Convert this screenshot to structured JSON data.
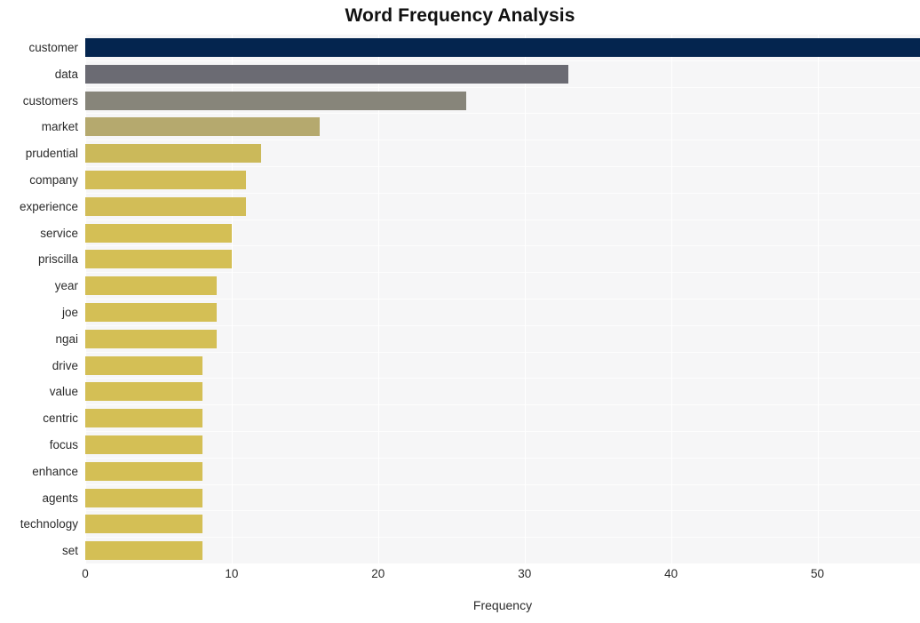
{
  "chart_data": {
    "type": "bar",
    "orientation": "horizontal",
    "title": "Word Frequency Analysis",
    "xlabel": "Frequency",
    "ylabel": "",
    "xlim": [
      0,
      57
    ],
    "ylim": null,
    "grid": true,
    "legend": null,
    "xticks": [
      0,
      10,
      20,
      30,
      40,
      50
    ],
    "xtick_labels": [
      "0",
      "10",
      "20",
      "30",
      "40",
      "50"
    ],
    "categories": [
      "customer",
      "data",
      "customers",
      "market",
      "prudential",
      "company",
      "experience",
      "service",
      "priscilla",
      "year",
      "joe",
      "ngai",
      "drive",
      "value",
      "centric",
      "focus",
      "enhance",
      "agents",
      "technology",
      "set"
    ],
    "values": [
      57,
      33,
      26,
      16,
      12,
      11,
      11,
      10,
      10,
      9,
      9,
      9,
      8,
      8,
      8,
      8,
      8,
      8,
      8,
      8
    ],
    "bar_colors": [
      "#04254f",
      "#6b6b73",
      "#87857a",
      "#b5a96e",
      "#cbb95a",
      "#d2bd57",
      "#d2bd57",
      "#d4bf55",
      "#d4bf55",
      "#d4bf55",
      "#d4bf55",
      "#d4bf55",
      "#d4bf55",
      "#d4bf55",
      "#d4bf55",
      "#d4bf55",
      "#d4bf55",
      "#d4bf55",
      "#d4bf55",
      "#d4bf55"
    ],
    "plot_background": "#f6f6f7",
    "figure_background": "#ffffff",
    "gridline_color": "#ffffff"
  }
}
